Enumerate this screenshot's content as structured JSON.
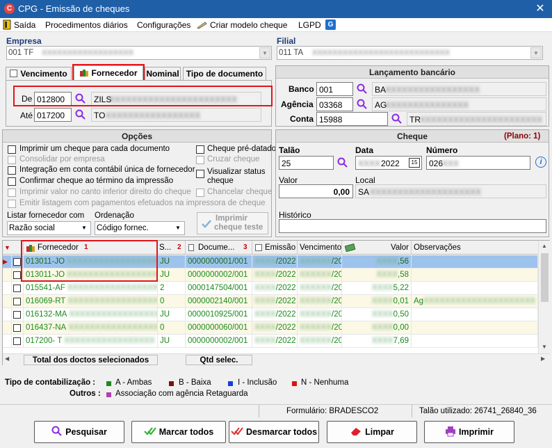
{
  "window": {
    "title": "CPG - Emissão de cheques",
    "close": "✕"
  },
  "menu": {
    "exit": "Saída",
    "daily": "Procedimentos diários",
    "config": "Configurações",
    "create_model": "Criar modelo cheque",
    "lgpd": "LGPD"
  },
  "empresa": {
    "label": "Empresa",
    "value": "001 TF"
  },
  "filial": {
    "label": "Filial",
    "value": "011 TA"
  },
  "tabs": {
    "vencimento": "Vencimento",
    "fornecedor": "Fornecedor",
    "nominal": "Nominal",
    "tipo": "Tipo de documento"
  },
  "fornecedor": {
    "de_label": "De",
    "de_code": "012800",
    "de_name": "ZILS",
    "ate_label": "Até",
    "ate_code": "017200",
    "ate_name": "TO"
  },
  "lancamento": {
    "title": "Lançamento bancário",
    "banco_label": "Banco",
    "banco": "001",
    "banco_name": "BA",
    "agencia_label": "Agência",
    "agencia": "03368",
    "agencia_name": "AG",
    "conta_label": "Conta",
    "conta": "15988",
    "conta_name": "TR"
  },
  "opcoes": {
    "title": "Opções",
    "items": [
      {
        "label": "Imprimir um cheque para cada documento",
        "enabled": true
      },
      {
        "label": "Consolidar por empresa",
        "enabled": false
      },
      {
        "label": "Integração em conta contábil única de fornecedor",
        "enabled": true
      },
      {
        "label": "Confirmar cheque ao término da impressão",
        "enabled": true
      },
      {
        "label": "Imprimir valor no canto inferior direito do cheque",
        "enabled": false
      },
      {
        "label": "Emitir listagem com pagamentos efetuados na impressora de cheque",
        "enabled": false
      }
    ],
    "right_items": [
      {
        "label": "Cheque pré-datado",
        "enabled": true
      },
      {
        "label": "Cruzar cheque",
        "enabled": false
      },
      {
        "label": "Visualizar status",
        "label2": "cheque",
        "enabled": true
      },
      {
        "label": "Chancelar cheque",
        "enabled": false
      }
    ],
    "listar_label": "Listar fornecedor com",
    "listar_value": "Razão social",
    "ordenacao_label": "Ordenação",
    "ordenacao_value": "Código fornec.",
    "print_test": "Imprimir",
    "print_test2": "cheque teste"
  },
  "cheque": {
    "title": "Cheque",
    "plano": "(Plano: 1)",
    "talao_label": "Talão",
    "talao": "25",
    "data_label": "Data",
    "data": "2022",
    "numero_label": "Número",
    "numero": "026",
    "valor_label": "Valor",
    "valor": "0,00",
    "local_label": "Local",
    "local": "SA",
    "historico_label": "Histórico",
    "info": "i"
  },
  "grid": {
    "headers": {
      "fornecedor": "Fornecedor",
      "f_sort": "1",
      "s": "S...",
      "s_sort": "2",
      "doc": "Docume...",
      "doc_sort": "3",
      "emissao": "Emissão",
      "vencimento": "Vencimento",
      "valor": "Valor",
      "obs": "Observações"
    },
    "rows": [
      {
        "fornecedor": "013011-JO",
        "s": "JU",
        "doc": "0000000001/001",
        "emissao": "/2022",
        "venc": "/2022",
        "valor": ",56",
        "obs": "",
        "selected": true
      },
      {
        "fornecedor": "013011-JO",
        "s": "JU",
        "doc": "0000000002/001",
        "emissao": "/2022",
        "venc": "/2022",
        "valor": ",58",
        "obs": ""
      },
      {
        "fornecedor": "015541-AF",
        "s": "2",
        "doc": "0000147504/001",
        "emissao": "/2022",
        "venc": "/2022",
        "valor": "5,22",
        "obs": ""
      },
      {
        "fornecedor": "016069-RT",
        "s": "0",
        "doc": "0000002140/001",
        "emissao": "/2022",
        "venc": "/2022",
        "valor": "0,01",
        "obs": "Ag"
      },
      {
        "fornecedor": "016132-MA",
        "s": "JU",
        "doc": "0000010925/001",
        "emissao": "/2022",
        "venc": "/2022",
        "valor": "0,50",
        "obs": ""
      },
      {
        "fornecedor": "016437-NA",
        "s": "0",
        "doc": "0000000060/001",
        "emissao": "/2022",
        "venc": "/2022",
        "valor": "0,00",
        "obs": ""
      },
      {
        "fornecedor": "017200- T",
        "s": "JU",
        "doc": "0000000002/001",
        "emissao": "/2022",
        "venc": "/2022",
        "valor": "7,69",
        "obs": ""
      }
    ],
    "footer_total": "Total dos doctos selecionados",
    "footer_qtd": "Qtd selec."
  },
  "legend": {
    "tipo_label": "Tipo de contabilização :",
    "items": [
      {
        "label": "A - Ambas",
        "color": "#1c8a1c"
      },
      {
        "label": "B - Baixa",
        "color": "#7a1010"
      },
      {
        "label": "I - Inclusão",
        "color": "#1a3ae0"
      },
      {
        "label": "N - Nenhuma",
        "color": "#e01010"
      }
    ],
    "outros_label": "Outros :",
    "outros_item": {
      "label": "Associação com agência Retaguarda",
      "color": "#b040b0"
    }
  },
  "status": {
    "formulario": "Formulário: BRADESCO2",
    "talao": "Talão utilizado: 26741_26840_36"
  },
  "buttons": {
    "pesquisar": "Pesquisar",
    "marcar": "Marcar todos",
    "desmarcar": "Desmarcar todos",
    "limpar": "Limpar",
    "imprimir": "Imprimir"
  }
}
